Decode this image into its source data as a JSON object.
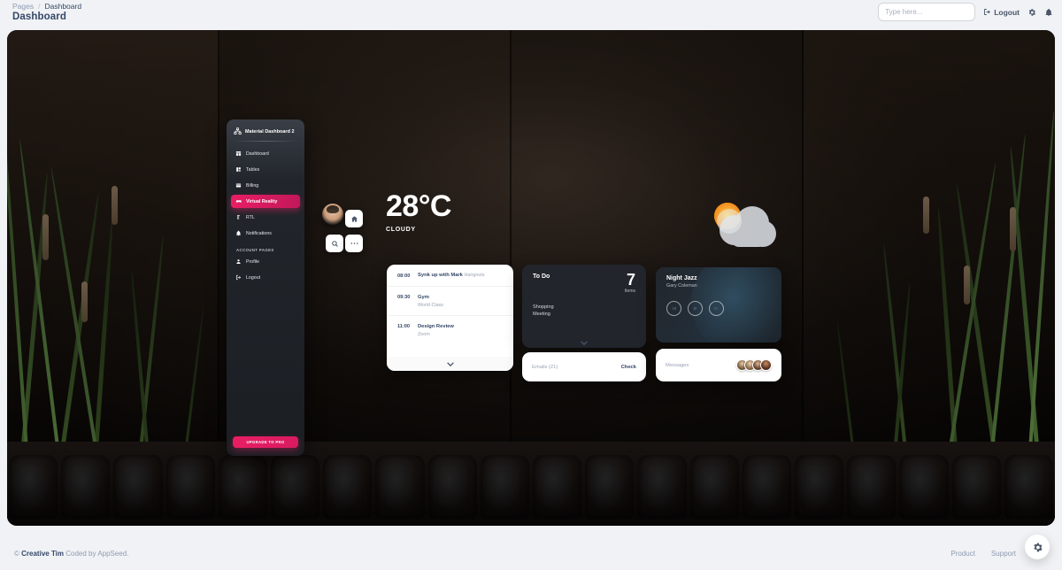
{
  "header": {
    "breadcrumb": {
      "root": "Pages",
      "separator": "/",
      "current": "Dashboard"
    },
    "page_title": "Dashboard",
    "search": {
      "placeholder": "Type here...",
      "value": "",
      "icon": "search-icon"
    },
    "logout_label": "Logout",
    "logout_icon": "logout-icon",
    "settings_icon": "gear-icon",
    "notifications_icon": "bell-icon"
  },
  "sidebar": {
    "brand": "Material Dashboard 2",
    "brand_icon": "sitemap-icon",
    "items": [
      {
        "label": "Dashboard",
        "icon": "dashboard-icon",
        "active": false
      },
      {
        "label": "Tables",
        "icon": "tables-icon",
        "active": false
      },
      {
        "label": "Billing",
        "icon": "billing-icon",
        "active": false
      },
      {
        "label": "Virtual Reality",
        "icon": "vr-icon",
        "active": true
      },
      {
        "label": "RTL",
        "icon": "rtl-icon",
        "active": false
      },
      {
        "label": "Notifications",
        "icon": "bell-icon",
        "active": false
      }
    ],
    "section_label": "ACCOUNT PAGES",
    "account_items": [
      {
        "label": "Profile",
        "icon": "person-icon"
      },
      {
        "label": "Logout",
        "icon": "logout-icon"
      }
    ],
    "upgrade_label": "UPGRADE TO PRO",
    "accent_color": "#e91e63"
  },
  "quick_actions": {
    "avatar": "user-avatar",
    "buttons": [
      {
        "name": "home-button",
        "icon": "home-icon"
      },
      {
        "name": "search-button",
        "icon": "search-icon"
      },
      {
        "name": "more-button",
        "icon": "dots-icon"
      }
    ]
  },
  "weather": {
    "temperature": "28°C",
    "condition": "CLOUDY",
    "icon": "sun-behind-cloud-icon"
  },
  "schedule": {
    "events": [
      {
        "time": "08:00",
        "title": "Synk up with Mark",
        "meta": "Hangouts",
        "sub": ""
      },
      {
        "time": "09:30",
        "title": "Gym",
        "meta": "",
        "sub": "World Class"
      },
      {
        "time": "11:00",
        "title": "Design Review",
        "meta": "",
        "sub": "Zoom"
      }
    ],
    "expand_icon": "chevron-down-icon"
  },
  "todo": {
    "title": "To Do",
    "count": "7",
    "unit": "Items",
    "items": [
      "Shopping",
      "Meeting"
    ],
    "expand_icon": "chevron-down-icon"
  },
  "music": {
    "title": "Night Jazz",
    "artist": "Gary Coleman",
    "controls": [
      {
        "name": "previous-button",
        "icon": "skip-previous-icon"
      },
      {
        "name": "play-button",
        "icon": "play-icon"
      },
      {
        "name": "next-button",
        "icon": "skip-next-icon"
      }
    ]
  },
  "emails": {
    "label": "Emails (21)",
    "action": "Check"
  },
  "messages": {
    "label": "Messages",
    "avatar_count": 4
  },
  "footer": {
    "copyright_symbol": "©",
    "brand": "Creative Tim",
    "credit": "Coded by AppSeed.",
    "links": [
      "Product",
      "Support"
    ],
    "settings_icon": "gear-icon"
  }
}
